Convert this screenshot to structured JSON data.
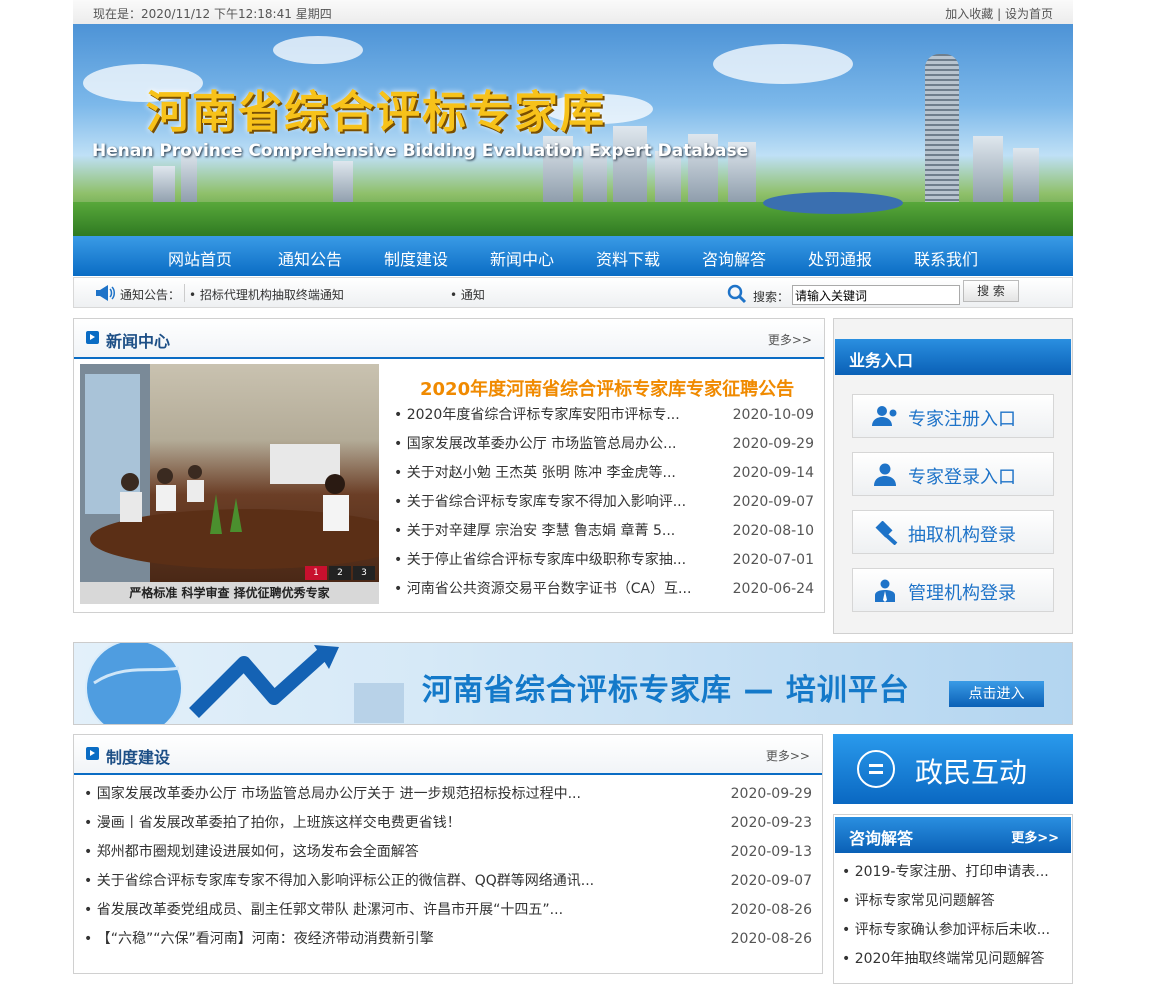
{
  "topbar": {
    "datetime": "现在是：2020/11/12 下午12:18:41 星期四",
    "bookmark": "加入收藏",
    "sep": "|",
    "homepage": "设为首页"
  },
  "banner": {
    "title_cn": "河南省综合评标专家库",
    "title_en": "Henan Province Comprehensive Bidding Evaluation Expert Database"
  },
  "nav": {
    "items": [
      "网站首页",
      "通知公告",
      "制度建设",
      "新闻中心",
      "资料下载",
      "咨询解答",
      "处罚通报",
      "联系我们"
    ]
  },
  "notice": {
    "label": "通知公告：",
    "items": [
      "• 招标代理机构抽取终端通知",
      "• 通知"
    ],
    "search_label": "搜索：",
    "search_value": "请输入关键词",
    "search_button": "搜 索"
  },
  "news": {
    "title": "新闻中心",
    "more": "更多>>",
    "photo_caption": "严格标准 科学审查 择优征聘优秀专家",
    "slides": [
      "1",
      "2",
      "3"
    ],
    "headline": "2020年度河南省综合评标专家库专家征聘公告",
    "items": [
      {
        "title": "• 2020年度省综合评标专家库安阳市评标专...",
        "date": "2020-10-09"
      },
      {
        "title": "• 国家发展改革委办公厅 市场监管总局办公...",
        "date": "2020-09-29"
      },
      {
        "title": "• 关于对赵小勉 王杰英 张明 陈冲 李金虎等...",
        "date": "2020-09-14"
      },
      {
        "title": "• 关于省综合评标专家库专家不得加入影响评...",
        "date": "2020-09-07"
      },
      {
        "title": "• 关于对辛建厚 宗治安 李慧 鲁志娟 章菁 5...",
        "date": "2020-08-10"
      },
      {
        "title": "• 关于停止省综合评标专家库中级职称专家抽...",
        "date": "2020-07-01"
      },
      {
        "title": "• 河南省公共资源交易平台数字证书（CA）互...",
        "date": "2020-06-24"
      }
    ]
  },
  "business": {
    "title": "业务入口",
    "buttons": [
      "专家注册入口",
      "专家登录入口",
      "抽取机构登录",
      "管理机构登录"
    ]
  },
  "training": {
    "title": "河南省综合评标专家库 — 培训平台",
    "enter": "点击进入"
  },
  "system": {
    "title": "制度建设",
    "more": "更多>>",
    "items": [
      {
        "title": "• 国家发展改革委办公厅 市场监管总局办公厅关于 进一步规范招标投标过程中...",
        "date": "2020-09-29"
      },
      {
        "title": "• 漫画丨省发展改革委拍了拍你，上班族这样交电费更省钱！",
        "date": "2020-09-23"
      },
      {
        "title": "• 郑州都市圈规划建设进展如何，这场发布会全面解答",
        "date": "2020-09-13"
      },
      {
        "title": "• 关于省综合评标专家库专家不得加入影响评标公正的微信群、QQ群等网络通讯...",
        "date": "2020-09-07"
      },
      {
        "title": "• 省发展改革委党组成员、副主任郭文带队 赴漯河市、许昌市开展“十四五”...",
        "date": "2020-08-26"
      },
      {
        "title": "• 【“六稳”“六保”看河南】河南：夜经济带动消费新引擎",
        "date": "2020-08-26"
      }
    ]
  },
  "gov": {
    "title": "政民互动"
  },
  "consult": {
    "title": "咨询解答",
    "more": "更多>>",
    "items": [
      "• 2019-专家注册、打印申请表...",
      "• 评标专家常见问题解答",
      "• 评标专家确认参加评标后未收...",
      "• 2020年抽取终端常见问题解答"
    ]
  }
}
